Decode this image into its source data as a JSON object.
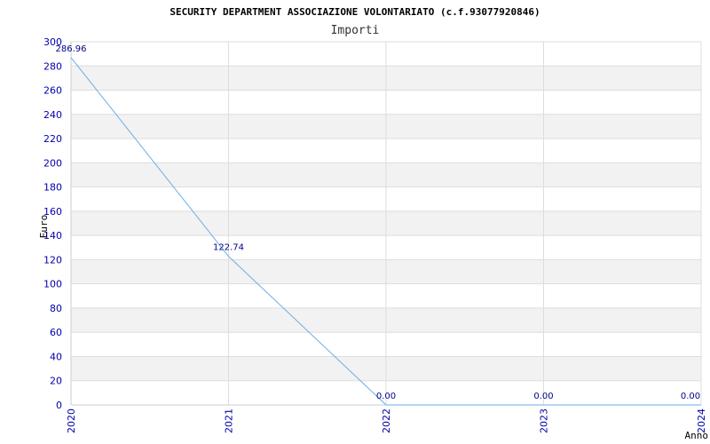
{
  "chart_data": {
    "type": "line",
    "title": "SECURITY DEPARTMENT ASSOCIAZIONE VOLONTARIATO (c.f.93077920846)",
    "subtitle": "Importi",
    "xlabel": "Anno",
    "ylabel": "Euro",
    "categories": [
      "2020",
      "2021",
      "2022",
      "2023",
      "2024"
    ],
    "series": [
      {
        "values": [
          286.96,
          122.74,
          0.0,
          0.0,
          0.0
        ],
        "labels": [
          "286.96",
          "122.74",
          "0.00",
          "0.00",
          "0.00"
        ]
      }
    ],
    "ylim": [
      0,
      300
    ],
    "yticks": [
      0,
      20,
      40,
      60,
      80,
      100,
      120,
      140,
      160,
      180,
      200,
      220,
      240,
      260,
      280,
      300
    ],
    "grid": true,
    "line_color": "#6aaee8",
    "band_color": "#f2f2f2",
    "gridline_color": "#dddddd",
    "tick_color": "#0000aa"
  }
}
